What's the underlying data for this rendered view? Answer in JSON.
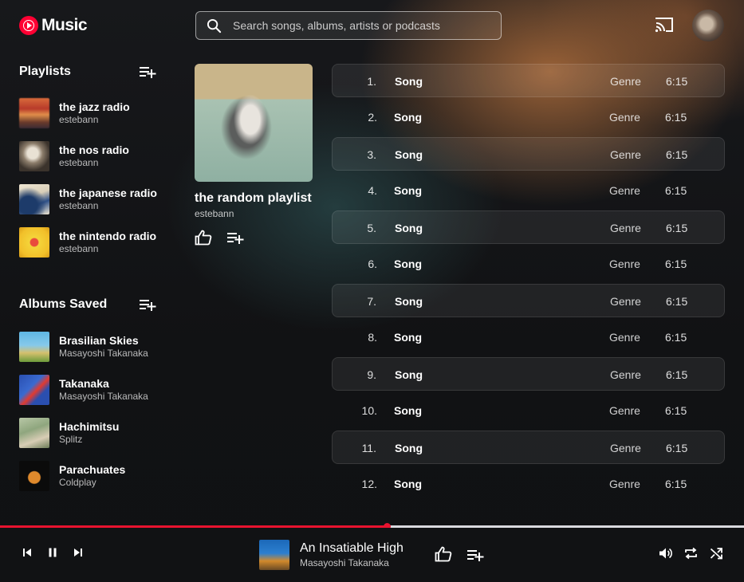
{
  "app": {
    "logo_text": "Music",
    "accent": "#ff0033"
  },
  "search": {
    "placeholder": "Search songs, albums, artists or podcasts",
    "value": ""
  },
  "header": {
    "cast_icon": "cast-icon",
    "avatar": "user-avatar"
  },
  "playlists": {
    "title": "Playlists",
    "items": [
      {
        "title": "the jazz radio",
        "owner": "estebann"
      },
      {
        "title": "the nos radio",
        "owner": "estebann"
      },
      {
        "title": "the japanese radio",
        "owner": "estebann"
      },
      {
        "title": "the nintendo radio",
        "owner": "estebann"
      }
    ]
  },
  "albums": {
    "title": "Albums Saved",
    "items": [
      {
        "title": "Brasilian Skies",
        "artist": "Masayoshi Takanaka"
      },
      {
        "title": "Takanaka",
        "artist": "Masayoshi Takanaka"
      },
      {
        "title": "Hachimitsu",
        "artist": "Splitz"
      },
      {
        "title": "Parachuates",
        "artist": "Coldplay"
      }
    ]
  },
  "current_playlist": {
    "title": "the random playlist",
    "owner": "estebann"
  },
  "tracks": [
    {
      "num": "1.",
      "name": "Song",
      "genre": "Genre",
      "duration": "6:15"
    },
    {
      "num": "2.",
      "name": "Song",
      "genre": "Genre",
      "duration": "6:15"
    },
    {
      "num": "3.",
      "name": "Song",
      "genre": "Genre",
      "duration": "6:15"
    },
    {
      "num": "4.",
      "name": "Song",
      "genre": "Genre",
      "duration": "6:15"
    },
    {
      "num": "5.",
      "name": "Song",
      "genre": "Genre",
      "duration": "6:15"
    },
    {
      "num": "6.",
      "name": "Song",
      "genre": "Genre",
      "duration": "6:15"
    },
    {
      "num": "7.",
      "name": "Song",
      "genre": "Genre",
      "duration": "6:15"
    },
    {
      "num": "8.",
      "name": "Song",
      "genre": "Genre",
      "duration": "6:15"
    },
    {
      "num": "9.",
      "name": "Song",
      "genre": "Genre",
      "duration": "6:15"
    },
    {
      "num": "10.",
      "name": "Song",
      "genre": "Genre",
      "duration": "6:15"
    },
    {
      "num": "11.",
      "name": "Song",
      "genre": "Genre",
      "duration": "6:15"
    },
    {
      "num": "12.",
      "name": "Song",
      "genre": "Genre",
      "duration": "6:15"
    }
  ],
  "player": {
    "progress": 0.52,
    "progress_color": "#e8132f",
    "now_playing": {
      "title": "An Insatiable High",
      "artist": "Masayoshi Takanaka"
    }
  }
}
